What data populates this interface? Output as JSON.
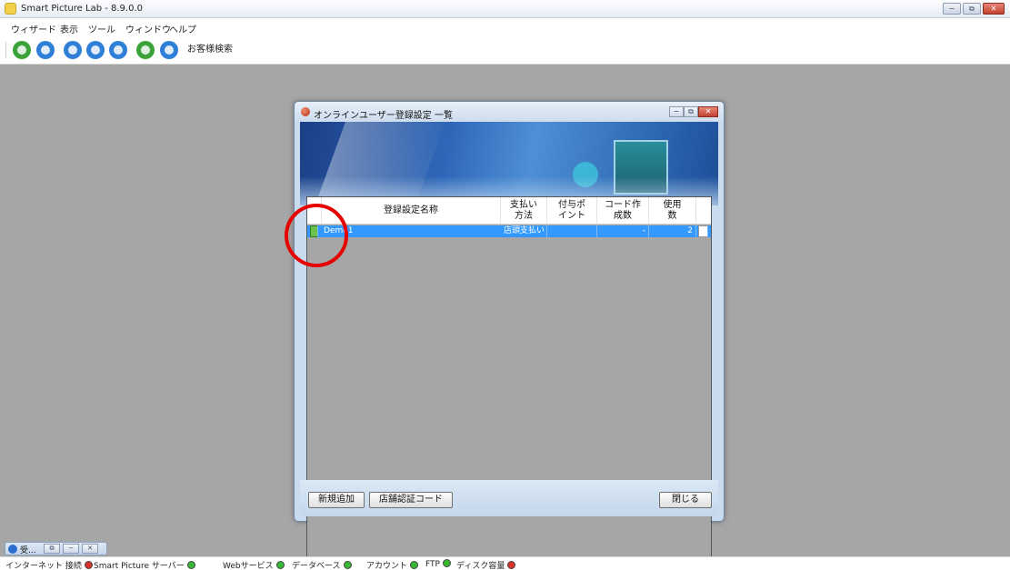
{
  "app": {
    "title": "Smart Picture Lab - 8.9.0.0"
  },
  "window_controls": {
    "minimize": "−",
    "restore": "⧉",
    "close": "✕"
  },
  "menu": [
    "ウィザード",
    "表示",
    "ツール",
    "ウィンドウ",
    "ヘルプ"
  ],
  "toolbar": {
    "buttons": [
      {
        "icon": "add-icon",
        "color": "#3aa33a"
      },
      {
        "icon": "users-icon",
        "color": "#2f7fd8"
      },
      {
        "icon": "users-icon",
        "color": "#2f7fd8"
      },
      {
        "icon": "power-icon",
        "color": "#2f7fd8"
      },
      {
        "icon": "network-icon",
        "color": "#2f7fd8"
      },
      {
        "icon": "disk-icon",
        "color": "#3aa33a"
      },
      {
        "icon": "chat-icon",
        "color": "#2f7fd8"
      }
    ],
    "search_label": "お客様検索"
  },
  "dialog": {
    "title": "オンラインユーザー登録設定 一覧",
    "columns": {
      "name": "登録設定名称",
      "payment_l1": "支払い",
      "payment_l2": "方法",
      "points_l1": "付与ポ",
      "points_l2": "イント",
      "codes_l1": "コード作",
      "codes_l2": "成数",
      "used_l1": "使用",
      "used_l2": "数"
    },
    "row": {
      "name": "Demo1",
      "payment": "店頭支払い",
      "points": "",
      "codes": "-",
      "used": "2",
      "delete_glyph": "✖"
    },
    "buttons": {
      "add": "新規追加",
      "store_code": "店舗認証コード",
      "close": "閉じる"
    }
  },
  "minimized_window": {
    "label": "受..."
  },
  "status_bar": [
    {
      "label": "インターネット 接続",
      "color": "#d9342b"
    },
    {
      "label": "Smart Picture サーバー",
      "color": "#37b832"
    },
    {
      "label": "Webサービス",
      "color": "#37b832"
    },
    {
      "label": "データベース",
      "color": "#37b832"
    },
    {
      "label": "アカウント",
      "color": "#37b832"
    },
    {
      "label": "FTP",
      "color": "#37b832"
    },
    {
      "label": "ディスク容量",
      "color": "#d9342b"
    }
  ]
}
